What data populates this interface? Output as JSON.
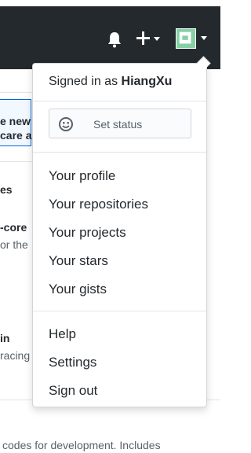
{
  "header": {
    "notifications_icon": "bell-icon",
    "create_icon": "plus-icon",
    "avatar_color": "#86d0a4",
    "bg_color": "#24292e"
  },
  "background_page": {
    "banner_line1": "e new c",
    "banner_line2": "care a",
    "section_heading": "es",
    "repo_name": "-core",
    "repo_desc": "or the",
    "repo2_name": "in",
    "repo2_desc": "racing",
    "footer_text": "codes for development. Includes"
  },
  "dropdown": {
    "signed_in_prefix": "Signed in as",
    "username": "HiangXu",
    "status_label": "Set status",
    "status_icon": "smiley-icon",
    "profile_items": [
      "Your profile",
      "Your repositories",
      "Your projects",
      "Your stars",
      "Your gists"
    ],
    "account_items": [
      "Help",
      "Settings",
      "Sign out"
    ]
  }
}
